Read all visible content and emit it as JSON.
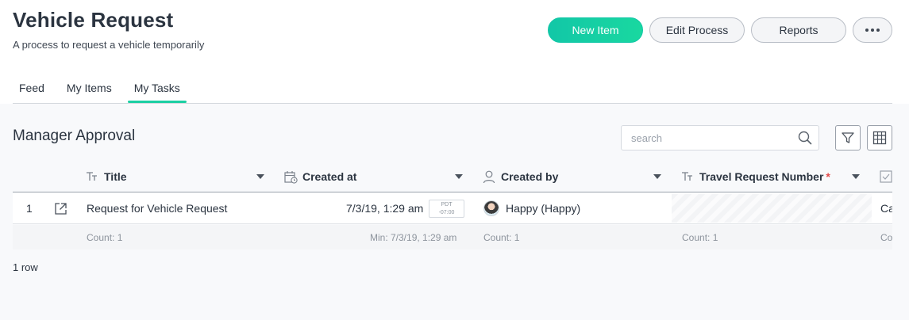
{
  "header": {
    "title": "Vehicle Request",
    "subtitle": "A process to request a vehicle temporarily",
    "buttons": {
      "new_item": "New Item",
      "edit_process": "Edit Process",
      "reports": "Reports"
    }
  },
  "tabs": [
    {
      "label": "Feed",
      "active": false
    },
    {
      "label": "My Items",
      "active": false
    },
    {
      "label": "My Tasks",
      "active": true
    }
  ],
  "section": {
    "title": "Manager Approval",
    "search_placeholder": "search"
  },
  "table": {
    "columns": [
      {
        "label": "Title",
        "icon": "text-type-icon"
      },
      {
        "label": "Created at",
        "icon": "calendar-clock-icon"
      },
      {
        "label": "Created by",
        "icon": "user-icon"
      },
      {
        "label": "Travel Request Number",
        "icon": "text-type-icon",
        "required_marker": "*"
      },
      {
        "label": "",
        "icon": "checkbox-icon"
      }
    ],
    "rows": [
      {
        "index": "1",
        "title": "Request for Vehicle Request",
        "created_at": "7/3/19, 1:29 am",
        "tz_abbr": "PDT",
        "tz_offset": "-07:00",
        "created_by": "Happy (Happy)",
        "travel_request_number": "",
        "last_col": "Ca"
      }
    ],
    "footer": {
      "title": "Count: 1",
      "created_at": "Min: 7/3/19, 1:29 am",
      "created_by": "Count: 1",
      "travel_request_number": "Count: 1",
      "last_col": "Co"
    }
  },
  "row_count": "1 row",
  "colors": {
    "accent": "#1ccfa3",
    "text": "#2b3440",
    "required": "#e34848"
  }
}
